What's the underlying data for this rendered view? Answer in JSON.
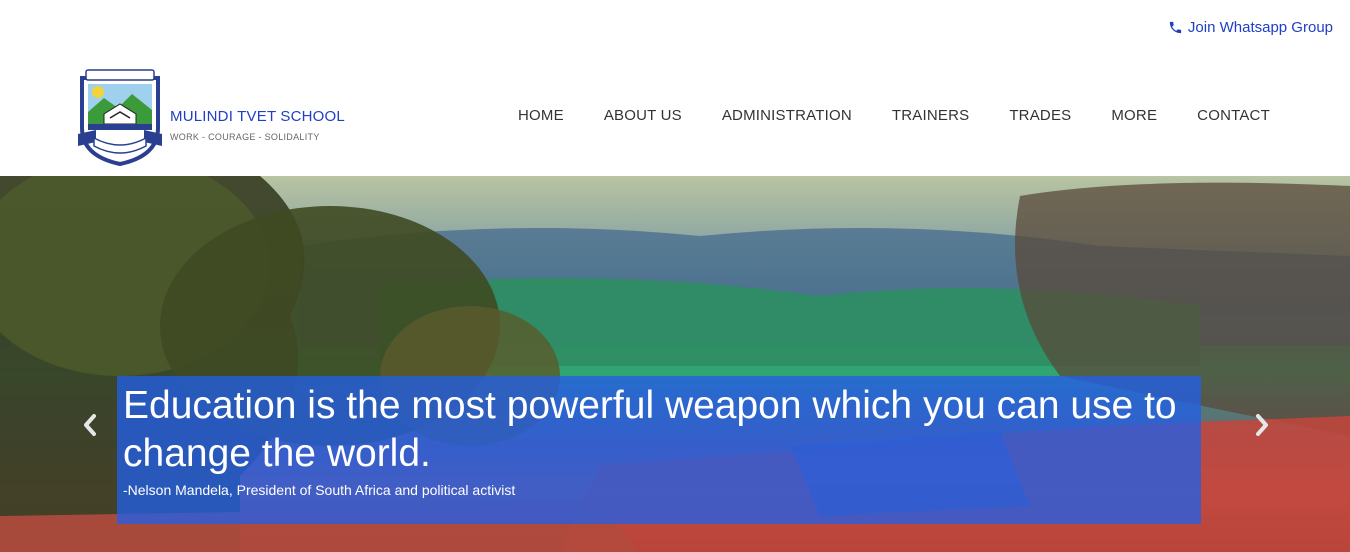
{
  "topbar": {
    "whatsapp_label": "Join Whatsapp Group",
    "whatsapp_icon": "phone-icon"
  },
  "brand": {
    "name": "MULINDI TVET SCHOOL",
    "motto": "WORK - COURAGE - SOLIDALITY",
    "logo_text": "MULINDI TVET SCHOOL"
  },
  "nav": {
    "items": [
      {
        "label": "HOME"
      },
      {
        "label": "ABOUT US"
      },
      {
        "label": "ADMINISTRATION"
      },
      {
        "label": "TRAINERS"
      },
      {
        "label": "TRADES"
      },
      {
        "label": "MORE"
      },
      {
        "label": "CONTACT"
      }
    ]
  },
  "hero": {
    "quote": "Education is the most powerful weapon which you can use to change the world.",
    "author": "-Nelson Mandela, President of South Africa and political activist",
    "prev_icon": "chevron-left-icon",
    "next_icon": "chevron-right-icon"
  },
  "colors": {
    "brand_blue": "#1f3fc4",
    "caption_bg": "#235fe6",
    "nav_text": "#333333"
  }
}
